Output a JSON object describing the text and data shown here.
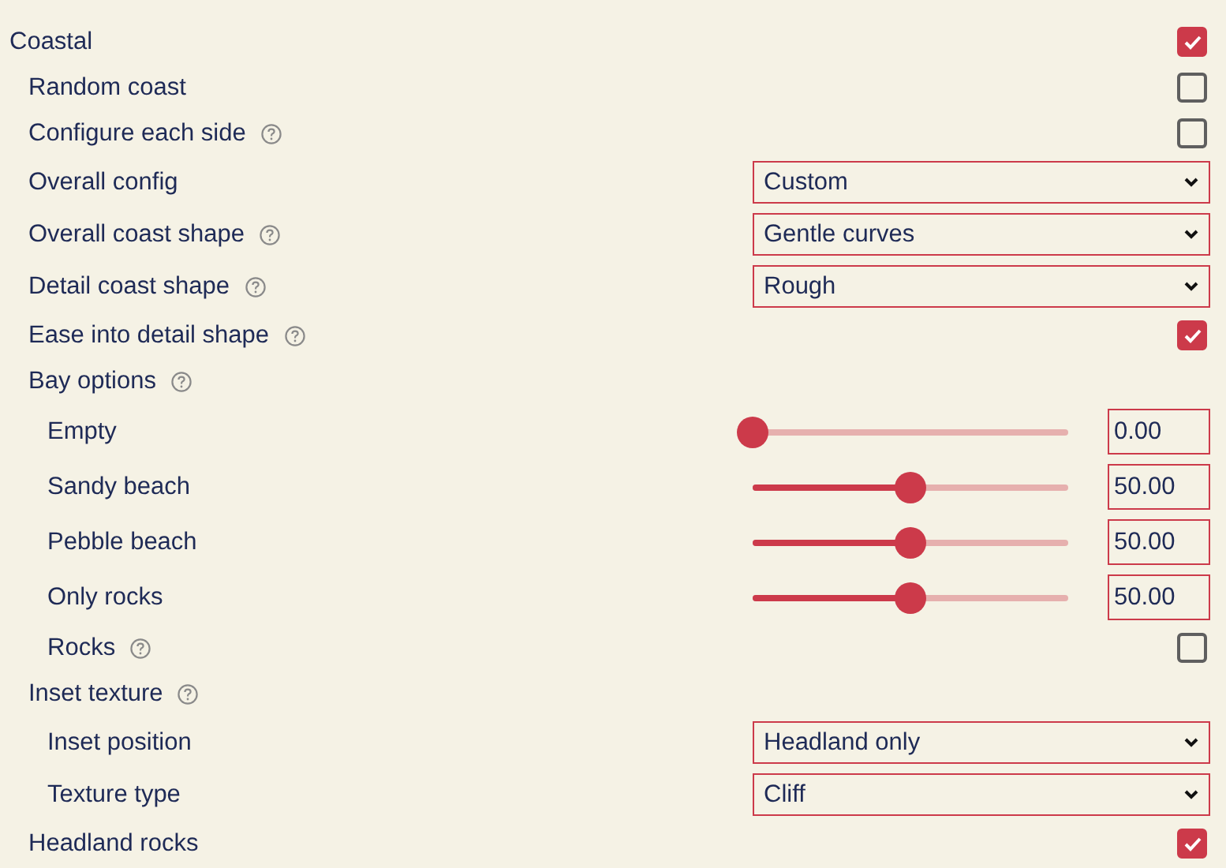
{
  "rows": [
    {
      "kind": "checkbox",
      "label": "Coastal",
      "help": false,
      "checked": true,
      "children": [
        {
          "kind": "checkbox",
          "label": "Random coast",
          "help": false,
          "checked": false
        },
        {
          "kind": "checkbox",
          "label": "Configure each side",
          "help": true,
          "checked": false
        },
        {
          "kind": "select",
          "label": "Overall config",
          "help": false,
          "value": "Custom"
        },
        {
          "kind": "select",
          "label": "Overall coast shape",
          "help": true,
          "value": "Gentle curves"
        },
        {
          "kind": "select",
          "label": "Detail coast shape",
          "help": true,
          "value": "Rough"
        },
        {
          "kind": "checkbox",
          "label": "Ease into detail shape",
          "help": true,
          "checked": true
        },
        {
          "kind": "heading",
          "label": "Bay options",
          "help": true,
          "children": [
            {
              "kind": "slider",
              "label": "Empty",
              "help": false,
              "level": 0,
              "value": "0.00"
            },
            {
              "kind": "slider",
              "label": "Sandy beach",
              "help": false,
              "level": 0.5,
              "value": "50.00"
            },
            {
              "kind": "slider",
              "label": "Pebble beach",
              "help": false,
              "level": 0.5,
              "value": "50.00"
            },
            {
              "kind": "slider",
              "label": "Only rocks",
              "help": false,
              "level": 0.5,
              "value": "50.00"
            },
            {
              "kind": "checkbox",
              "label": "Rocks",
              "help": true,
              "checked": false
            }
          ]
        },
        {
          "kind": "heading",
          "label": "Inset texture",
          "help": true,
          "children": [
            {
              "kind": "select",
              "label": "Inset position",
              "help": false,
              "value": "Headland only"
            },
            {
              "kind": "select",
              "label": "Texture type",
              "help": false,
              "value": "Cliff"
            }
          ]
        },
        {
          "kind": "checkbox",
          "label": "Headland rocks",
          "help": false,
          "checked": true
        }
      ]
    }
  ]
}
